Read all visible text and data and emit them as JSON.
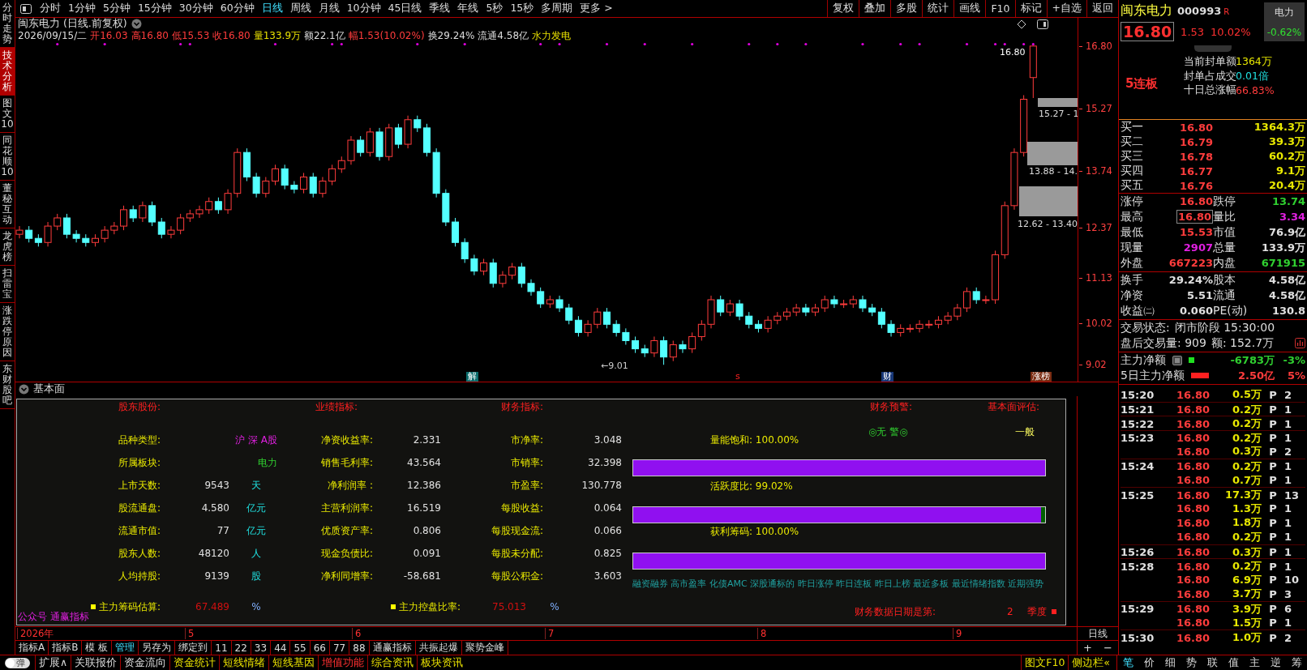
{
  "side_tabs": [
    {
      "label": "分时走势",
      "selected": false
    },
    {
      "label": "技术分析",
      "selected": true
    },
    {
      "label": "图文10",
      "selected": false
    },
    {
      "label": "同花顺10",
      "selected": false
    },
    {
      "label": "董秘互动",
      "selected": false
    },
    {
      "label": "龙虎榜",
      "selected": false
    },
    {
      "label": "扫雷宝",
      "selected": false
    },
    {
      "label": "涨跌停原因",
      "selected": false
    },
    {
      "label": "东财股吧",
      "selected": false
    }
  ],
  "toolbar": {
    "periods": [
      {
        "label": "分时",
        "selected": false
      },
      {
        "label": "1分钟",
        "selected": false
      },
      {
        "label": "5分钟",
        "selected": false
      },
      {
        "label": "15分钟",
        "selected": false
      },
      {
        "label": "30分钟",
        "selected": false
      },
      {
        "label": "60分钟",
        "selected": false
      },
      {
        "label": "日线",
        "selected": true
      },
      {
        "label": "周线",
        "selected": false
      },
      {
        "label": "月线",
        "selected": false
      },
      {
        "label": "10分钟",
        "selected": false
      },
      {
        "label": "45日线",
        "selected": false
      },
      {
        "label": "季线",
        "selected": false
      },
      {
        "label": "年线",
        "selected": false
      },
      {
        "label": "5秒",
        "selected": false
      },
      {
        "label": "15秒",
        "selected": false
      },
      {
        "label": "多周期",
        "selected": false
      },
      {
        "label": "更多 >",
        "selected": false
      }
    ],
    "buttons": [
      "复权",
      "叠加",
      "多股",
      "统计",
      "画线",
      "F10",
      "标记",
      "+自选",
      "返回"
    ]
  },
  "chart": {
    "title": "闽东电力 (日线.前复权)",
    "info": [
      {
        "text": "2026/09/15/二",
        "kind": "plain"
      },
      {
        "text": "开16.03",
        "kind": "rise"
      },
      {
        "text": "高16.80",
        "kind": "rise"
      },
      {
        "text": "低15.53",
        "kind": "rise"
      },
      {
        "text": "收16.80",
        "kind": "rise"
      },
      {
        "text": "量133.9万",
        "kind": "volume"
      },
      {
        "text": "额22.1亿",
        "kind": "plain"
      },
      {
        "text": "幅1.53(10.02%)",
        "kind": "rise"
      },
      {
        "text": "换29.24%",
        "kind": "plain"
      },
      {
        "text": "流通4.58亿",
        "kind": "plain"
      },
      {
        "text": "水力发电",
        "kind": "volume"
      }
    ],
    "annotations": [
      {
        "text": "16.80",
        "kind": "last"
      },
      {
        "text": "15.27 - 1",
        "kind": "zone"
      },
      {
        "text": "13.88 - 14.",
        "kind": "zone"
      },
      {
        "text": "12.62 - 13.40",
        "kind": "zone"
      },
      {
        "text": "←9.01",
        "kind": "low"
      }
    ],
    "events": [
      {
        "label": "解",
        "kind": "unlock"
      },
      {
        "label": "s",
        "kind": "text"
      },
      {
        "label": "财",
        "kind": "report"
      },
      {
        "label": "涨榜",
        "kind": "list"
      }
    ],
    "date_axis": [
      "2026年",
      "5",
      "6",
      "7",
      "8",
      "9"
    ],
    "period": "日线",
    "chart_data": {
      "type": "candlestick",
      "ylim": [
        8.6,
        17.49
      ],
      "yticks": [
        {
          "value": 16.8,
          "label": "16.80"
        },
        {
          "value": 15.27,
          "label": "15.27"
        },
        {
          "value": 13.74,
          "label": "13.74"
        },
        {
          "value": 12.37,
          "label": "12.37"
        },
        {
          "value": 11.13,
          "label": "11.13"
        },
        {
          "value": 10.02,
          "label": "10.02"
        },
        {
          "value": 9.02,
          "label": "9.02"
        }
      ],
      "ohlc": [
        [
          12.2,
          12.4,
          12.1,
          12.3
        ],
        [
          12.3,
          12.4,
          12.0,
          12.1
        ],
        [
          12.1,
          12.2,
          11.9,
          12.0
        ],
        [
          12.0,
          12.5,
          11.9,
          12.4
        ],
        [
          12.4,
          12.7,
          12.3,
          12.6
        ],
        [
          12.6,
          12.7,
          12.1,
          12.2
        ],
        [
          12.2,
          12.3,
          12.0,
          12.1
        ],
        [
          12.1,
          12.2,
          11.9,
          12.0
        ],
        [
          12.0,
          12.2,
          11.9,
          12.1
        ],
        [
          12.1,
          12.4,
          12.0,
          12.3
        ],
        [
          12.3,
          12.5,
          12.2,
          12.4
        ],
        [
          12.4,
          12.9,
          12.3,
          12.8
        ],
        [
          12.8,
          12.9,
          12.5,
          12.6
        ],
        [
          12.6,
          13.0,
          12.5,
          12.9
        ],
        [
          12.9,
          13.0,
          12.4,
          12.5
        ],
        [
          12.5,
          12.6,
          12.1,
          12.2
        ],
        [
          12.2,
          12.4,
          12.1,
          12.3
        ],
        [
          12.3,
          12.7,
          12.2,
          12.6
        ],
        [
          12.6,
          12.8,
          12.5,
          12.7
        ],
        [
          12.7,
          12.9,
          12.6,
          12.8
        ],
        [
          12.8,
          13.1,
          12.7,
          13.0
        ],
        [
          13.0,
          13.1,
          12.7,
          12.8
        ],
        [
          12.8,
          13.3,
          12.7,
          13.2
        ],
        [
          13.2,
          14.3,
          13.1,
          14.2
        ],
        [
          14.2,
          14.3,
          13.5,
          13.6
        ],
        [
          13.6,
          13.7,
          13.1,
          13.2
        ],
        [
          13.2,
          13.6,
          13.1,
          13.5
        ],
        [
          13.5,
          13.9,
          13.4,
          13.8
        ],
        [
          13.8,
          13.9,
          13.3,
          13.4
        ],
        [
          13.4,
          13.5,
          13.2,
          13.3
        ],
        [
          13.3,
          13.7,
          13.2,
          13.6
        ],
        [
          13.6,
          13.7,
          13.1,
          13.2
        ],
        [
          13.2,
          13.6,
          13.1,
          13.5
        ],
        [
          13.5,
          13.9,
          13.4,
          13.8
        ],
        [
          13.8,
          14.1,
          13.7,
          14.0
        ],
        [
          14.0,
          14.6,
          13.9,
          14.5
        ],
        [
          14.5,
          14.6,
          14.1,
          14.2
        ],
        [
          14.2,
          14.8,
          14.1,
          14.7
        ],
        [
          14.7,
          14.8,
          14.0,
          14.1
        ],
        [
          14.1,
          14.9,
          14.0,
          14.8
        ],
        [
          14.8,
          14.9,
          14.3,
          14.4
        ],
        [
          14.4,
          15.1,
          14.3,
          15.0
        ],
        [
          15.0,
          15.1,
          14.7,
          14.8
        ],
        [
          14.8,
          14.9,
          14.1,
          14.2
        ],
        [
          14.2,
          14.3,
          13.1,
          13.2
        ],
        [
          13.2,
          13.3,
          12.4,
          12.5
        ],
        [
          12.5,
          12.6,
          11.9,
          12.0
        ],
        [
          12.0,
          12.1,
          11.5,
          11.6
        ],
        [
          11.6,
          11.7,
          11.2,
          11.3
        ],
        [
          11.3,
          11.6,
          11.2,
          11.5
        ],
        [
          11.5,
          11.6,
          10.9,
          11.0
        ],
        [
          11.0,
          11.3,
          10.9,
          11.2
        ],
        [
          11.2,
          11.5,
          11.1,
          11.4
        ],
        [
          11.4,
          11.5,
          10.9,
          11.0
        ],
        [
          11.0,
          11.1,
          10.7,
          10.8
        ],
        [
          10.8,
          10.9,
          10.4,
          10.5
        ],
        [
          10.5,
          10.7,
          10.4,
          10.6
        ],
        [
          10.6,
          10.7,
          10.3,
          10.4
        ],
        [
          10.4,
          10.5,
          10.0,
          10.1
        ],
        [
          10.1,
          10.2,
          9.7,
          9.8
        ],
        [
          9.8,
          10.1,
          9.7,
          10.0
        ],
        [
          10.0,
          10.4,
          9.9,
          10.3
        ],
        [
          10.3,
          10.4,
          9.9,
          10.0
        ],
        [
          10.0,
          10.1,
          9.7,
          9.8
        ],
        [
          9.8,
          9.9,
          9.5,
          9.6
        ],
        [
          9.6,
          9.7,
          9.3,
          9.4
        ],
        [
          9.4,
          9.5,
          9.2,
          9.3
        ],
        [
          9.3,
          9.7,
          9.2,
          9.6
        ],
        [
          9.6,
          9.7,
          9.01,
          9.2
        ],
        [
          9.2,
          9.6,
          9.1,
          9.5
        ],
        [
          9.5,
          9.6,
          9.3,
          9.4
        ],
        [
          9.4,
          9.8,
          9.3,
          9.7
        ],
        [
          9.7,
          10.1,
          9.6,
          10.0
        ],
        [
          10.0,
          10.7,
          9.9,
          10.6
        ],
        [
          10.6,
          10.7,
          10.2,
          10.3
        ],
        [
          10.3,
          10.6,
          10.2,
          10.5
        ],
        [
          10.5,
          10.6,
          10.1,
          10.2
        ],
        [
          10.2,
          10.3,
          9.9,
          10.0
        ],
        [
          10.0,
          10.1,
          9.8,
          9.9
        ],
        [
          9.9,
          10.2,
          9.8,
          10.1
        ],
        [
          10.1,
          10.3,
          10.0,
          10.2
        ],
        [
          10.2,
          10.4,
          10.1,
          10.3
        ],
        [
          10.3,
          10.5,
          10.2,
          10.4
        ],
        [
          10.4,
          10.5,
          10.2,
          10.3
        ],
        [
          10.3,
          10.5,
          10.2,
          10.4
        ],
        [
          10.4,
          10.7,
          10.3,
          10.6
        ],
        [
          10.6,
          10.7,
          10.4,
          10.5
        ],
        [
          10.5,
          10.6,
          10.4,
          10.5
        ],
        [
          10.5,
          10.7,
          10.4,
          10.6
        ],
        [
          10.6,
          10.7,
          10.3,
          10.4
        ],
        [
          10.4,
          10.5,
          10.2,
          10.3
        ],
        [
          10.3,
          10.4,
          9.9,
          10.0
        ],
        [
          10.0,
          10.1,
          9.7,
          9.8
        ],
        [
          9.8,
          10.0,
          9.7,
          9.9
        ],
        [
          9.9,
          10.0,
          9.8,
          9.9
        ],
        [
          9.9,
          10.1,
          9.8,
          10.0
        ],
        [
          10.0,
          10.1,
          9.9,
          10.0
        ],
        [
          10.0,
          10.2,
          9.9,
          10.1
        ],
        [
          10.1,
          10.3,
          10.0,
          10.2
        ],
        [
          10.2,
          10.5,
          10.1,
          10.4
        ],
        [
          10.4,
          10.9,
          10.3,
          10.8
        ],
        [
          10.8,
          10.9,
          10.5,
          10.6
        ],
        [
          10.6,
          10.7,
          10.5,
          10.6
        ],
        [
          10.6,
          11.8,
          10.5,
          11.7
        ],
        [
          11.7,
          13.0,
          11.6,
          12.9
        ],
        [
          12.9,
          14.3,
          12.8,
          14.2
        ],
        [
          14.2,
          15.6,
          14.1,
          15.5
        ],
        [
          16.03,
          16.8,
          15.53,
          16.8
        ]
      ]
    }
  },
  "fundamentals": {
    "title": "基本面",
    "headers": [
      "股东股份:",
      "业绩指标:",
      "财务指标:"
    ],
    "rows": [
      {
        "holding": {
          "label": "品种类型:",
          "value": "沪 深 A股",
          "kind": "market"
        },
        "performance": {
          "label": "净资收益率:",
          "value": "2.331"
        },
        "finance": {
          "label": "市净率:",
          "value": "3.048"
        }
      },
      {
        "holding": {
          "label": "所属板块:",
          "value": "电力",
          "kind": "sector"
        },
        "performance": {
          "label": "销售毛利率:",
          "value": "43.564"
        },
        "finance": {
          "label": "市销率:",
          "value": "32.398"
        }
      },
      {
        "holding": {
          "label": "上市天数:",
          "value": "9543",
          "unit": "天",
          "kind": "number"
        },
        "performance": {
          "label": "净利润率 :",
          "value": "12.386"
        },
        "finance": {
          "label": "市盈率:",
          "value": "130.778"
        }
      },
      {
        "holding": {
          "label": "股流通盘:",
          "value": "4.580",
          "unit": "亿元",
          "kind": "number"
        },
        "performance": {
          "label": "主营利润率:",
          "value": "16.519"
        },
        "finance": {
          "label": "每股收益:",
          "value": "0.064"
        }
      },
      {
        "holding": {
          "label": "流通市值:",
          "value": "77",
          "unit": "亿元",
          "kind": "number"
        },
        "performance": {
          "label": "优质资产率:",
          "value": "0.806"
        },
        "finance": {
          "label": "每股现金流:",
          "value": "0.066"
        }
      },
      {
        "holding": {
          "label": "股东人数:",
          "value": "48120",
          "unit": "人",
          "kind": "number"
        },
        "performance": {
          "label": "现金负债比:",
          "value": "0.091"
        },
        "finance": {
          "label": "每股未分配:",
          "value": "0.825"
        }
      },
      {
        "holding": {
          "label": "人均持股:",
          "value": "9139",
          "unit": "股",
          "kind": "number"
        },
        "performance": {
          "label": "净利同增率:",
          "value": "-58.681"
        },
        "finance": {
          "label": "每股公积金:",
          "value": "3.603"
        }
      }
    ],
    "summary": [
      {
        "label": "主力筹码估算:",
        "value": "67.489",
        "unit": "%"
      },
      {
        "label": "主力控盘比率:",
        "value": "75.013",
        "unit": "%"
      }
    ],
    "footer": "公众号 通赢指标",
    "warning_title": "财务预警:",
    "warning": "◎无 警◎",
    "rating_title": "基本面评估:",
    "rating": "一般",
    "meters": [
      {
        "label": "量能饱和:",
        "reading": "100.00%",
        "level": 1
      },
      {
        "label": "活跃度比:",
        "reading": "99.02%",
        "level": 0.99
      },
      {
        "label": "获利筹码:",
        "reading": "100.00%",
        "level": 1
      }
    ],
    "concepts": "融资融券 高市盈率 化债AMC 深股通标的 昨日涨停 昨日连板 昨日上榜 最近多板 最近情绪指数 近期强势",
    "report": {
      "label": "财务数据日期是第:",
      "value": "2",
      "unit": "季度"
    }
  },
  "indicator_tabs": [
    {
      "label": "指标A",
      "selected": false
    },
    {
      "label": "指标B",
      "selected": false
    },
    {
      "label": "模 板",
      "selected": false
    },
    {
      "label": "管理",
      "selected": true
    },
    {
      "label": "另存为",
      "selected": false
    },
    {
      "label": "绑定到",
      "selected": false
    },
    {
      "label": "11",
      "selected": false
    },
    {
      "label": "22",
      "selected": false
    },
    {
      "label": "33",
      "selected": false
    },
    {
      "label": "44",
      "selected": false
    },
    {
      "label": "55",
      "selected": false
    },
    {
      "label": "66",
      "selected": false
    },
    {
      "label": "77",
      "selected": false
    },
    {
      "label": "88",
      "selected": false
    },
    {
      "label": "通赢指标",
      "selected": false
    },
    {
      "label": "共振起爆",
      "selected": false
    },
    {
      "label": "聚势金峰",
      "selected": false
    }
  ],
  "zoom_buttons": [
    "+",
    "−"
  ],
  "quote": {
    "name": "闽东电力",
    "code": "000993",
    "badge": "R",
    "price": "16.80",
    "change": "1.53",
    "change_pct": "10.02%",
    "sector": "电力",
    "sector_change": "-0.62%"
  },
  "seal": {
    "streak": "5连板",
    "items": [
      {
        "label": "当前封单额",
        "value": "1364万",
        "kind": "amount"
      },
      {
        "label": "封单占成交",
        "value": "0.01倍",
        "kind": "ratio"
      },
      {
        "label": "十日总涨幅",
        "value": "66.83%",
        "kind": "gain"
      }
    ]
  },
  "order_book": [
    {
      "label": "买一",
      "price": "16.80",
      "volume": "1364.3万"
    },
    {
      "label": "买二",
      "price": "16.79",
      "volume": "39.3万"
    },
    {
      "label": "买三",
      "price": "16.78",
      "volume": "60.2万"
    },
    {
      "label": "买四",
      "price": "16.77",
      "volume": "9.1万"
    },
    {
      "label": "买五",
      "price": "16.76",
      "volume": "20.4万"
    }
  ],
  "stats": [
    {
      "label": "涨停",
      "value": "16.80",
      "kind": "up"
    },
    {
      "label": "跌停",
      "value": "13.74",
      "kind": "down"
    },
    {
      "label": "最高",
      "value": "16.80",
      "kind": "high"
    },
    {
      "label": "量比",
      "value": "3.34",
      "kind": "volume"
    },
    {
      "label": "最低",
      "value": "15.53",
      "kind": "up"
    },
    {
      "label": "市值",
      "value": "76.9亿",
      "kind": "plain"
    },
    {
      "label": "现量",
      "value": "2907",
      "kind": "volume"
    },
    {
      "label": "总量",
      "value": "133.9万",
      "kind": "plain"
    },
    {
      "label": "外盘",
      "value": "667223",
      "kind": "up"
    },
    {
      "label": "内盘",
      "value": "671915",
      "kind": "down"
    }
  ],
  "capital": [
    {
      "label": "换手",
      "value": "29.24%"
    },
    {
      "label": "股本",
      "value": "4.58亿"
    },
    {
      "label": "净资",
      "value": "5.51"
    },
    {
      "label": "流通",
      "value": "4.58亿"
    },
    {
      "label": "收益㈡",
      "value": "0.060"
    },
    {
      "label": "PE(动)",
      "value": "130.8"
    }
  ],
  "trade_status": {
    "label": "交易状态:",
    "value": "闭市阶段 15:30:00",
    "after_label": "盘后交易量: 909",
    "after_amount": "额: 152.7万"
  },
  "main_flow": [
    {
      "label": "主力净额",
      "value": "-6783万",
      "pct": "-3%",
      "kind": "down"
    },
    {
      "label": "5日主力净额",
      "value": "2.50亿",
      "pct": "5%",
      "kind": "up"
    }
  ],
  "ticks": [
    {
      "time": "15:20",
      "price": "16.80",
      "volume": "0.5万",
      "side": "P",
      "count": "2"
    },
    {
      "time": "15:21",
      "price": "16.80",
      "volume": "0.2万",
      "side": "P",
      "count": "1"
    },
    {
      "time": "15:22",
      "price": "16.80",
      "volume": "0.2万",
      "side": "P",
      "count": "1"
    },
    {
      "time": "15:23",
      "price": "16.80",
      "volume": "0.2万",
      "side": "P",
      "count": "1"
    },
    {
      "price": "16.80",
      "volume": "0.3万",
      "side": "P",
      "count": "2"
    },
    {
      "time": "15:24",
      "price": "16.80",
      "volume": "0.2万",
      "side": "P",
      "count": "1"
    },
    {
      "price": "16.80",
      "volume": "0.7万",
      "side": "P",
      "count": "1"
    },
    {
      "time": "15:25",
      "price": "16.80",
      "volume": "17.3万",
      "side": "P",
      "count": "13"
    },
    {
      "price": "16.80",
      "volume": "1.3万",
      "side": "P",
      "count": "1"
    },
    {
      "price": "16.80",
      "volume": "1.8万",
      "side": "P",
      "count": "1"
    },
    {
      "price": "16.80",
      "volume": "0.2万",
      "side": "P",
      "count": "1"
    },
    {
      "time": "15:26",
      "price": "16.80",
      "volume": "0.3万",
      "side": "P",
      "count": "1"
    },
    {
      "time": "15:28",
      "price": "16.80",
      "volume": "0.2万",
      "side": "P",
      "count": "1"
    },
    {
      "price": "16.80",
      "volume": "6.9万",
      "side": "P",
      "count": "10"
    },
    {
      "price": "16.80",
      "volume": "3.7万",
      "side": "P",
      "count": "3"
    },
    {
      "time": "15:29",
      "price": "16.80",
      "volume": "3.9万",
      "side": "P",
      "count": "6"
    },
    {
      "price": "16.80",
      "volume": "1.5万",
      "side": "P",
      "count": "1"
    },
    {
      "time": "15:30",
      "price": "16.80",
      "volume": "1.0万",
      "side": "P",
      "count": "2"
    }
  ],
  "bottom_bar": {
    "toggle": {
      "label": "弹",
      "on": false
    },
    "items": [
      {
        "label": "扩展∧",
        "kind": "normal"
      },
      {
        "label": "关联报价",
        "kind": "normal"
      },
      {
        "label": "资金流向",
        "kind": "normal"
      },
      {
        "label": "资金统计",
        "kind": "feature"
      },
      {
        "label": "短线情绪",
        "kind": "feature"
      },
      {
        "label": "短线基因",
        "kind": "feature"
      },
      {
        "label": "增值功能",
        "kind": "premium"
      },
      {
        "label": "综合资讯",
        "kind": "feature"
      },
      {
        "label": "板块资讯",
        "kind": "feature"
      }
    ],
    "side_links": [
      "图文F10",
      "侧边栏«"
    ],
    "panel_tabs": [
      {
        "label": "笔",
        "selected": true
      },
      {
        "label": "价",
        "selected": false
      },
      {
        "label": "细",
        "selected": false
      },
      {
        "label": "势",
        "selected": false
      },
      {
        "label": "联",
        "selected": false
      },
      {
        "label": "值",
        "selected": false
      },
      {
        "label": "主",
        "selected": false
      },
      {
        "label": "逆",
        "selected": false
      },
      {
        "label": "筹",
        "selected": false
      }
    ]
  }
}
